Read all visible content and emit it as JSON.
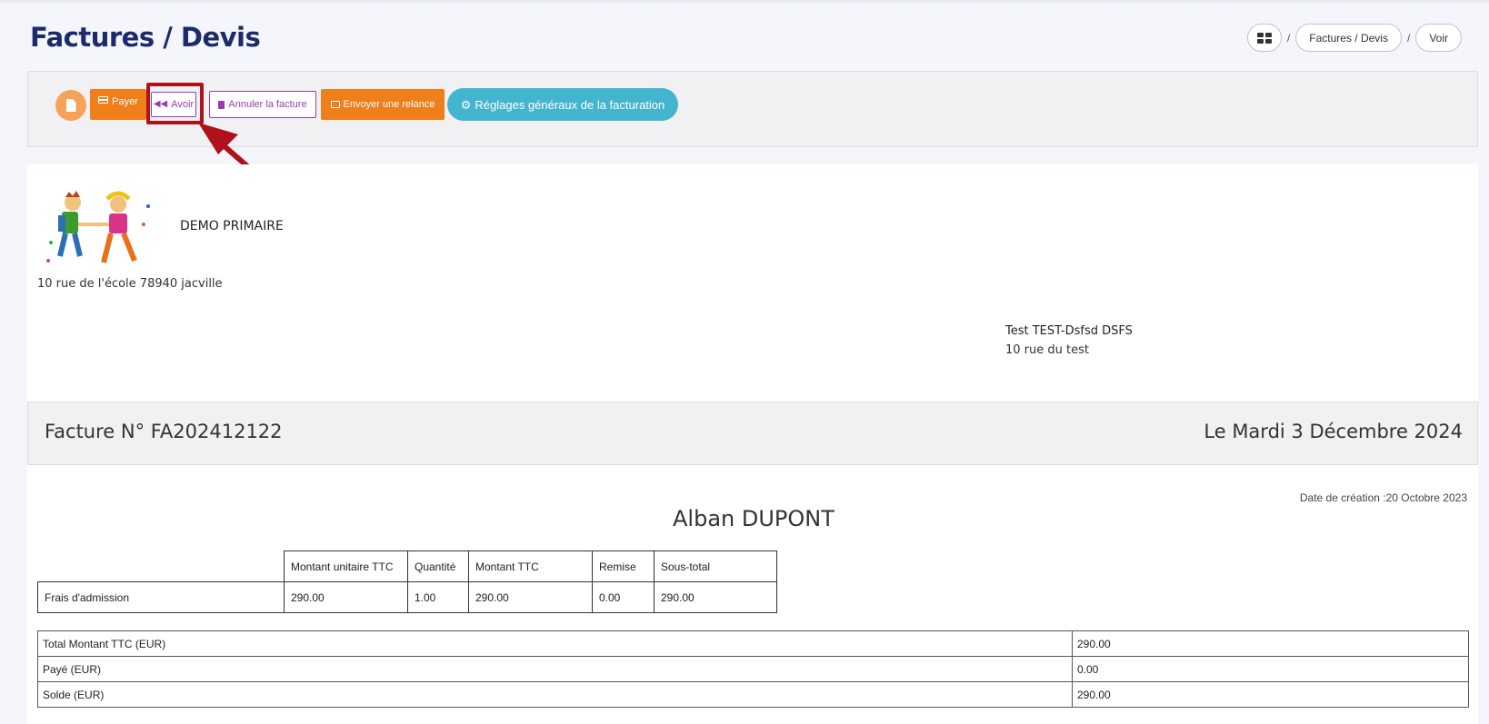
{
  "page": {
    "title": "Factures / Devis"
  },
  "breadcrumb": {
    "items": [
      "Factures / Devis",
      "Voir"
    ],
    "separator": "/"
  },
  "toolbar": {
    "payer_label": "Payer",
    "avoir_label": "Avoir",
    "annuler_label": "Annuler la facture",
    "relance_label": "Envoyer une relance",
    "reglages_label": "Réglages généraux de la facturation"
  },
  "school": {
    "name": "DEMO PRIMAIRE",
    "address": "10 rue de l'école 78940 jacville"
  },
  "client": {
    "name": "Test TEST-Dsfsd DSFS",
    "address": "10 rue du test"
  },
  "invoice": {
    "number": "Facture N° FA202412122",
    "date": "Le Mardi 3 Décembre 2024",
    "creation_date": "Date de création :20 Octobre 2023",
    "student": "Alban DUPONT",
    "columns": [
      "Montant unitaire TTC",
      "Quantité",
      "Montant TTC",
      "Remise",
      "Sous-total"
    ],
    "rows": [
      {
        "label": "Frais d'admission",
        "unit": "290.00",
        "qty": "1.00",
        "ttc": "290.00",
        "remise": "0.00",
        "subtotal": "290.00"
      }
    ],
    "totals": [
      {
        "label": "Total Montant TTC (EUR)",
        "value": "290.00"
      },
      {
        "label": "Payé (EUR)",
        "value": "0.00"
      },
      {
        "label": "Solde (EUR)",
        "value": "290.00"
      }
    ]
  },
  "colors": {
    "title": "#1c2b6b",
    "orange": "#ef7f1a",
    "purple": "#9b3ab0",
    "cyan": "#44b5cf",
    "highlight": "#b0121b"
  }
}
